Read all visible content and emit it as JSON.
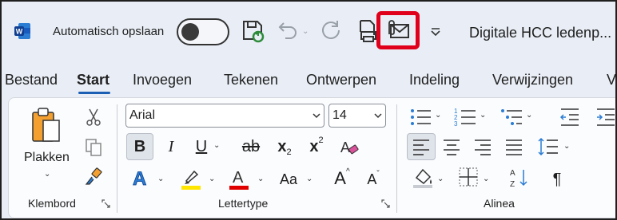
{
  "titlebar": {
    "autosave_label": "Automatisch opslaan",
    "document_title": "Digitale HCC ledenp..."
  },
  "tabs": [
    {
      "label": "Bestand"
    },
    {
      "label": "Start",
      "active": true
    },
    {
      "label": "Invoegen"
    },
    {
      "label": "Tekenen"
    },
    {
      "label": "Ontwerpen"
    },
    {
      "label": "Indeling"
    },
    {
      "label": "Verwijzingen"
    },
    {
      "label": "V"
    }
  ],
  "clipboard": {
    "paste_label": "Plakken",
    "group_label": "Klembord"
  },
  "font": {
    "font_name": "Arial",
    "font_size": "14",
    "group_label": "Lettertype",
    "bold": "B",
    "italic": "I",
    "underline": "U",
    "strikethrough": "ab",
    "subscript": "x",
    "subscript_mark": "2",
    "superscript": "x",
    "superscript_mark": "2",
    "text_effects": "A",
    "change_case": "Aa",
    "grow_font": "A",
    "shrink_font": "A"
  },
  "paragraph": {
    "group_label": "Alinea",
    "show_marks": "¶"
  },
  "colors": {
    "accent_blue": "#1a5fb4",
    "highlight_yellow": "#ffe600",
    "font_color_red": "#e00000",
    "callout_red": "#e0001b"
  }
}
